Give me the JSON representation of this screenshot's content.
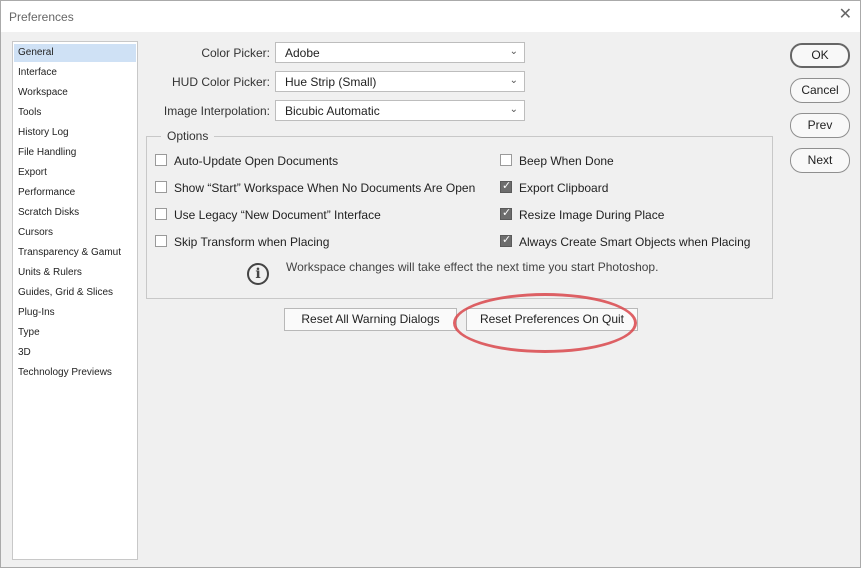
{
  "window": {
    "title": "Preferences",
    "close": "✕"
  },
  "sidebar": {
    "items": [
      {
        "label": "General",
        "active": true
      },
      {
        "label": "Interface"
      },
      {
        "label": "Workspace"
      },
      {
        "label": "Tools"
      },
      {
        "label": "History Log"
      },
      {
        "label": "File Handling"
      },
      {
        "label": "Export"
      },
      {
        "label": "Performance"
      },
      {
        "label": "Scratch Disks"
      },
      {
        "label": "Cursors"
      },
      {
        "label": "Transparency & Gamut"
      },
      {
        "label": "Units & Rulers"
      },
      {
        "label": "Guides, Grid & Slices"
      },
      {
        "label": "Plug-Ins"
      },
      {
        "label": "Type"
      },
      {
        "label": "3D"
      },
      {
        "label": "Technology Previews"
      }
    ]
  },
  "fields": {
    "color_picker": {
      "label": "Color Picker:",
      "value": "Adobe"
    },
    "hud_color_picker": {
      "label": "HUD Color Picker:",
      "value": "Hue Strip (Small)"
    },
    "image_interpolation": {
      "label": "Image Interpolation:",
      "value": "Bicubic Automatic"
    }
  },
  "options": {
    "legend": "Options",
    "left": [
      {
        "label": "Auto-Update Open Documents",
        "checked": false
      },
      {
        "label": "Show “Start” Workspace When No Documents Are Open",
        "checked": false
      },
      {
        "label": "Use Legacy “New Document” Interface",
        "checked": false
      },
      {
        "label": "Skip Transform when Placing",
        "checked": false
      }
    ],
    "right": [
      {
        "label": "Beep When Done",
        "checked": false
      },
      {
        "label": "Export Clipboard",
        "checked": true
      },
      {
        "label": "Resize Image During Place",
        "checked": true
      },
      {
        "label": "Always Create Smart Objects when Placing",
        "checked": true
      }
    ],
    "info": "Workspace changes will take effect the next time you start Photoshop."
  },
  "buttons": {
    "reset_warnings": "Reset All Warning Dialogs",
    "reset_prefs": "Reset Preferences On Quit",
    "ok": "OK",
    "cancel": "Cancel",
    "prev": "Prev",
    "next": "Next"
  },
  "colors": {
    "annotation": "#d9464b",
    "selected_item": "#cfe1f5"
  }
}
